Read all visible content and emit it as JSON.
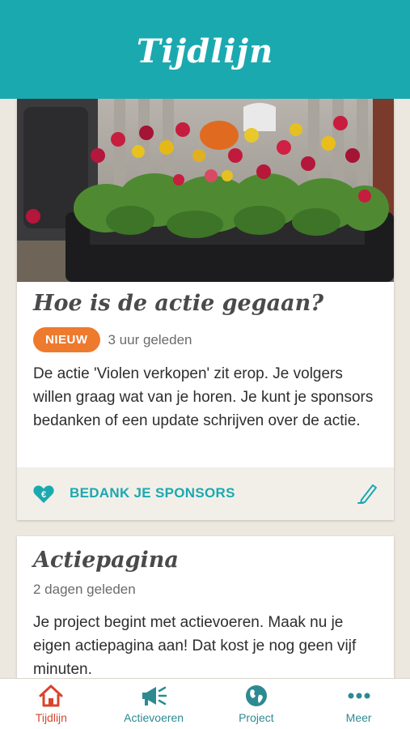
{
  "header": {
    "title": "Tijdlijn"
  },
  "feed": {
    "cards": [
      {
        "title": "Hoe is de actie gegaan?",
        "badge": "NIEUW",
        "time": "3 uur geleden",
        "body": "De actie 'Violen verkopen' zit erop. Je volgers willen graag wat van je horen. Je kunt je sponsors bedanken of een update schrijven over de actie.",
        "action_label": "BEDANK JE SPONSORS"
      },
      {
        "title": "Actiepagina",
        "time": "2 dagen geleden",
        "body": "Je project begint met actievoeren. Maak nu je eigen actiepagina aan! Dat kost je nog geen vijf minuten."
      }
    ]
  },
  "tabbar": {
    "tabs": [
      {
        "label": "Tijdlijn",
        "icon": "home-icon",
        "active": true
      },
      {
        "label": "Actievoeren",
        "icon": "megaphone-icon",
        "active": false
      },
      {
        "label": "Project",
        "icon": "globe-icon",
        "active": false
      },
      {
        "label": "Meer",
        "icon": "more-dots-icon",
        "active": false
      }
    ]
  },
  "colors": {
    "brand": "#1ba9b0",
    "badge": "#ee7a2e",
    "active_tab": "#d8442c",
    "background": "#ece7df"
  }
}
